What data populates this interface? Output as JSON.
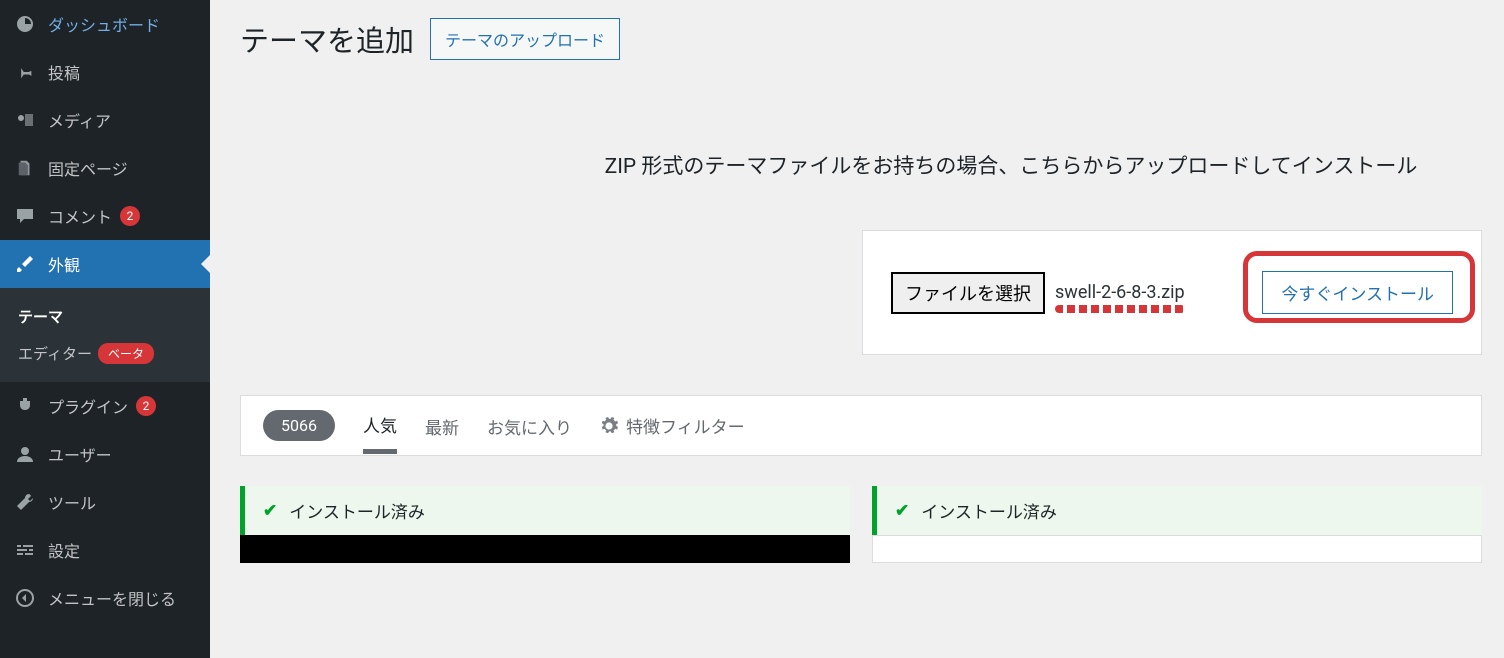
{
  "sidebar": {
    "dashboard": "ダッシュボード",
    "posts": "投稿",
    "media": "メディア",
    "pages": "固定ページ",
    "comments": "コメント",
    "comments_count": "2",
    "appearance": "外観",
    "appearance_sub": {
      "themes": "テーマ",
      "editor": "エディター",
      "editor_badge": "ベータ"
    },
    "plugins": "プラグイン",
    "plugins_count": "2",
    "users": "ユーザー",
    "tools": "ツール",
    "settings": "設定",
    "collapse": "メニューを閉じる"
  },
  "header": {
    "title": "テーマを追加",
    "upload_button": "テーマのアップロード"
  },
  "upload": {
    "description": "ZIP 形式のテーマファイルをお持ちの場合、こちらからアップロードしてインストール",
    "choose_file": "ファイルを選択",
    "selected_file": "swell-2-6-8-3.zip",
    "install_now": "今すぐインストール"
  },
  "filters": {
    "count": "5066",
    "popular": "人気",
    "latest": "最新",
    "favorites": "お気に入り",
    "feature_filter": "特徴フィルター"
  },
  "themes": {
    "installed_label": "インストール済み"
  }
}
